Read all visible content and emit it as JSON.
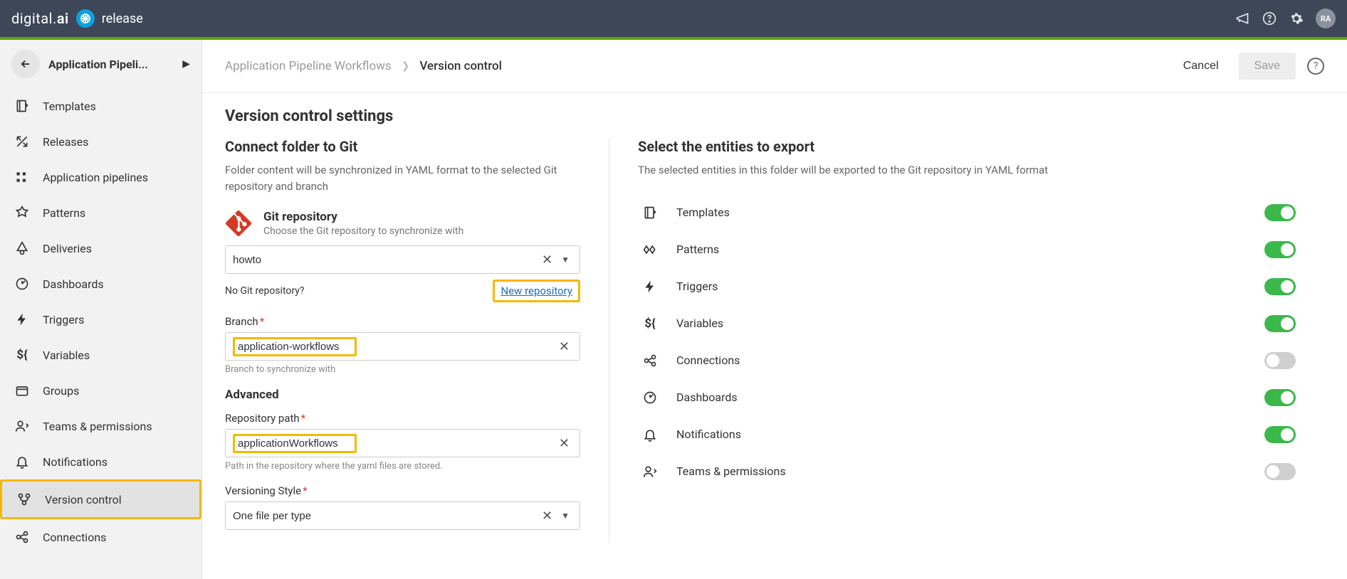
{
  "brand": {
    "name1": "digital",
    "name2": "ai",
    "product": "release"
  },
  "avatar": "RA",
  "sidebar": {
    "title": "Application Pipeli...",
    "items": [
      {
        "label": "Templates"
      },
      {
        "label": "Releases"
      },
      {
        "label": "Application pipelines"
      },
      {
        "label": "Patterns"
      },
      {
        "label": "Deliveries"
      },
      {
        "label": "Dashboards"
      },
      {
        "label": "Triggers"
      },
      {
        "label": "Variables"
      },
      {
        "label": "Groups"
      },
      {
        "label": "Teams & permissions"
      },
      {
        "label": "Notifications"
      },
      {
        "label": "Version control"
      },
      {
        "label": "Connections"
      }
    ]
  },
  "breadcrumb": {
    "parent": "Application Pipeline Workflows",
    "current": "Version control"
  },
  "actions": {
    "cancel": "Cancel",
    "save": "Save"
  },
  "page": {
    "title": "Version control settings"
  },
  "left": {
    "title": "Connect folder to Git",
    "desc": "Folder content will be synchronized in YAML format to the selected Git repository and branch",
    "git_label": "Git repository",
    "git_sub": "Choose the Git repository to synchronize with",
    "repo_value": "howto",
    "no_repo": "No Git repository?",
    "new_repo": "New repository",
    "branch_label": "Branch",
    "branch_value": "application-workflows",
    "branch_hint": "Branch to synchronize with",
    "advanced": "Advanced",
    "repo_path_label": "Repository path",
    "repo_path_value": "applicationWorkflows",
    "repo_path_hint": "Path in the repository where the yaml files are stored.",
    "vstyle_label": "Versioning Style",
    "vstyle_value": "One file per type"
  },
  "right": {
    "title": "Select the entities to export",
    "desc": "The selected entities in this folder will be exported to the Git repository in YAML format",
    "entities": [
      {
        "label": "Templates",
        "on": true
      },
      {
        "label": "Patterns",
        "on": true
      },
      {
        "label": "Triggers",
        "on": true
      },
      {
        "label": "Variables",
        "on": true
      },
      {
        "label": "Connections",
        "on": false
      },
      {
        "label": "Dashboards",
        "on": true
      },
      {
        "label": "Notifications",
        "on": true
      },
      {
        "label": "Teams & permissions",
        "on": false
      }
    ]
  }
}
